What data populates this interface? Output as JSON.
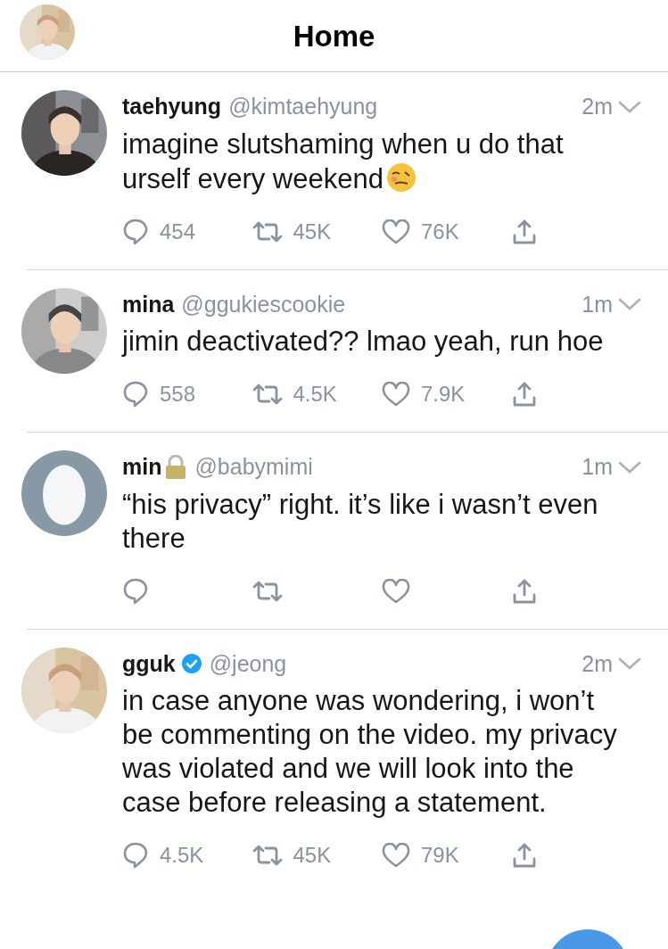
{
  "header": {
    "title": "Home"
  },
  "tweets": [
    {
      "name": "taehyung",
      "locked": false,
      "verified": false,
      "handle": "@kimtaehyung",
      "time": "2m",
      "text": "imagine slutshaming when u do that urself every weekend",
      "emoji_at_end": true,
      "reply_count": "454",
      "retweet_count": "45K",
      "like_count": "76K"
    },
    {
      "name": "mina",
      "locked": false,
      "verified": false,
      "handle": "@ggukiescookie",
      "time": "1m",
      "text": "jimin deactivated?? lmao yeah, run hoe",
      "emoji_at_end": false,
      "reply_count": "558",
      "retweet_count": "4.5K",
      "like_count": "7.9K"
    },
    {
      "avatar": {
        "kind": "default"
      },
      "name": "min",
      "locked": true,
      "verified": false,
      "handle": "@babymimi",
      "time": "1m",
      "text": "“his privacy” right. it’s like i wasn’t even there",
      "emoji_at_end": false
    },
    {
      "name": "gguk",
      "locked": false,
      "verified": true,
      "handle": "@jeong",
      "time": "2m",
      "text": "in case anyone was wondering, i won’t be commenting on the video. my privacy was violated and we will look into the case before releasing a statement.",
      "emoji_at_end": false,
      "reply_count": "4.5K",
      "retweet_count": "45K",
      "like_count": "79K"
    }
  ],
  "compose_button": {
    "kind": "floating"
  }
}
